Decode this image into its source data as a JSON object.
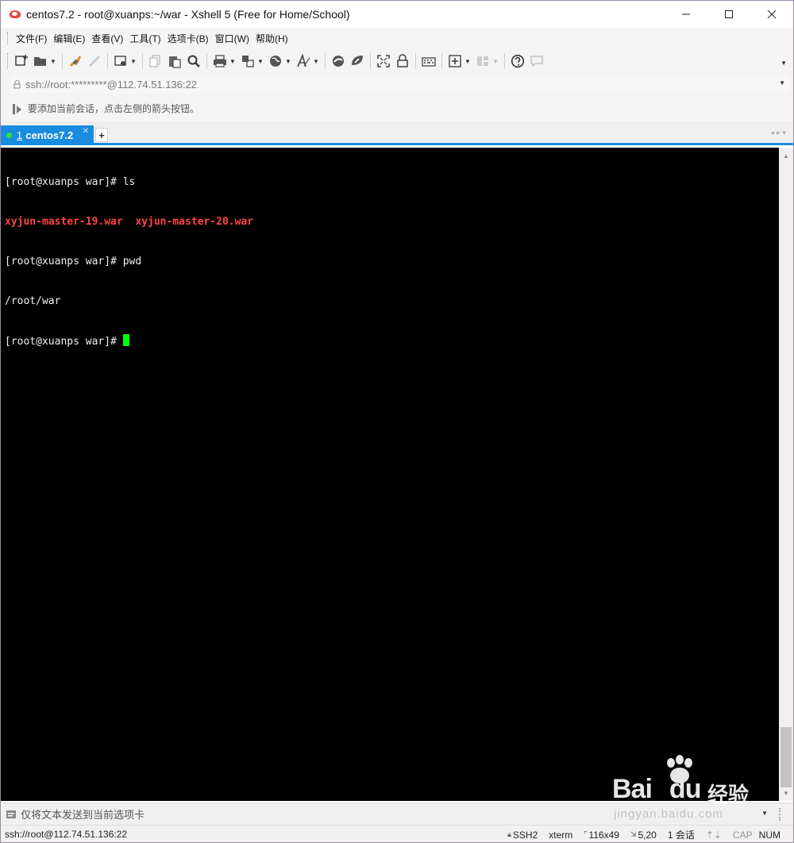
{
  "window": {
    "title": "centos7.2 - root@xuanps:~/war - Xshell 5 (Free for Home/School)",
    "controls": [
      "minimize",
      "maximize",
      "close"
    ]
  },
  "menu": {
    "items": [
      "文件(F)",
      "编辑(E)",
      "查看(V)",
      "工具(T)",
      "选项卡(B)",
      "窗口(W)",
      "帮助(H)"
    ]
  },
  "toolbar": {
    "icons": [
      "new-session-icon",
      "open-folder-icon",
      "connect-icon",
      "disconnect-icon",
      "properties-icon",
      "copy-icon",
      "paste-icon",
      "find-icon",
      "print-icon",
      "transfer-icon",
      "globe-icon",
      "font-icon",
      "xftp-icon",
      "xmanager-icon",
      "fullscreen-icon",
      "lock-icon",
      "keyboard-icon",
      "new-tab-icon",
      "layout-icon",
      "help-icon",
      "chat-icon"
    ]
  },
  "address": {
    "value": "ssh://root:*********@112.74.51.136:22"
  },
  "hint": {
    "text": "要添加当前会话，点击左侧的箭头按钮。"
  },
  "tabs": [
    {
      "number": "1",
      "label": "centos7.2",
      "active": true,
      "status_color": "#30e030"
    }
  ],
  "terminal": {
    "lines": [
      {
        "prompt": "[root@xuanps war]# ",
        "cmd": "ls"
      },
      {
        "files": [
          "xyjun-master-19.war",
          "xyjun-master-20.war"
        ]
      },
      {
        "prompt": "[root@xuanps war]# ",
        "cmd": "pwd"
      },
      {
        "output": "/root/war"
      },
      {
        "prompt": "[root@xuanps war]# ",
        "cmd": ""
      }
    ],
    "file_color": "#ff4545",
    "cursor_color": "#00ff00"
  },
  "compose": {
    "text": "仅将文本发送到当前选项卡"
  },
  "status": {
    "connection": "ssh://root@112.74.51.136:22",
    "protocol": "SSH2",
    "terminal_type": "xterm",
    "size": "116x49",
    "cursor_pos": "5,20",
    "sessions": "1 会话",
    "cap": "CAP",
    "num": "NUM"
  },
  "watermark": {
    "brand": "Bai",
    "brand2": "du",
    "cn": "经验",
    "url": "jingyan.baidu.com"
  },
  "colors": {
    "accent": "#1a8ce0",
    "terminal_bg": "#000000"
  }
}
